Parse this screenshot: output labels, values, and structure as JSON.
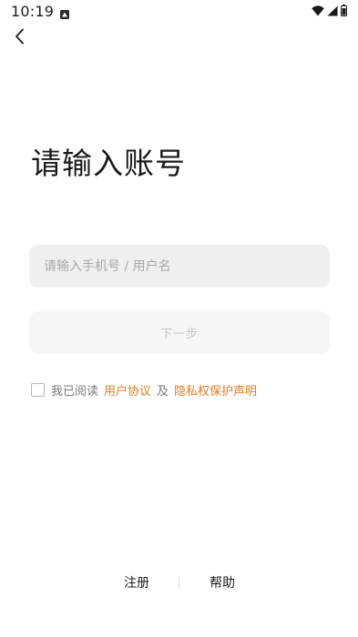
{
  "status_bar": {
    "time": "10:19"
  },
  "icons": {
    "notification": "notification-icon",
    "wifi": "wifi-icon",
    "signal": "cellular-signal-icon",
    "battery": "battery-icon",
    "back": "back-arrow-icon"
  },
  "title": "请输入账号",
  "account_input": {
    "placeholder": "请输入手机号 / 用户名",
    "value": ""
  },
  "next_button": {
    "label": "下一步",
    "enabled": false
  },
  "agreement": {
    "checked": false,
    "prefix": "我已阅读",
    "user_agreement": "用户协议",
    "conjunction": "及",
    "privacy_statement": "隐私权保护声明"
  },
  "bottom": {
    "register": "注册",
    "help": "帮助"
  },
  "colors": {
    "accent": "#e67e22",
    "input_bg": "#efefef",
    "button_disabled_bg": "#f6f6f6",
    "button_disabled_text": "#c4c4c4"
  }
}
